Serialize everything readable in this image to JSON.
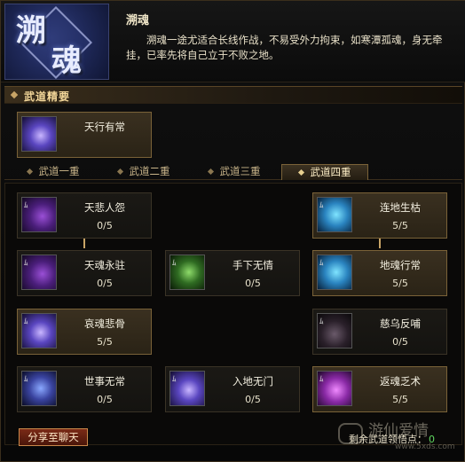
{
  "header": {
    "emblem_chars": [
      "溯",
      "魂"
    ],
    "title": "溯魂",
    "description": "溯魂一途尤适合长线作战，不易受外力拘束，如寒潭孤魂，身无牵挂，已率先将自己立于不败之地。"
  },
  "summary_section": {
    "title": "武道精要",
    "skill": {
      "name": "天行有常",
      "icon": "spirit-icon"
    }
  },
  "tabs": [
    {
      "label": "武道一重",
      "active": false
    },
    {
      "label": "武道二重",
      "active": false
    },
    {
      "label": "武道三重",
      "active": false
    },
    {
      "label": "武道四重",
      "active": true
    }
  ],
  "skill_level_symbol": "ﾑ",
  "skills": [
    {
      "name": "天悲人怨",
      "level": "0/5",
      "active": false,
      "icon": "purple-spirit-icon"
    },
    {
      "name": "连地生枯",
      "level": "5/5",
      "active": true,
      "icon": "blue-wave-icon"
    },
    {
      "name": "天魂永驻",
      "level": "0/5",
      "active": false,
      "icon": "purple-spirit-icon"
    },
    {
      "name": "手下无情",
      "level": "0/5",
      "active": false,
      "icon": "green-spirit-icon"
    },
    {
      "name": "地魂行常",
      "level": "5/5",
      "active": true,
      "icon": "blue-figure-icon"
    },
    {
      "name": "哀魂悲骨",
      "level": "5/5",
      "active": true,
      "icon": "violet-burst-icon"
    },
    {
      "name": "慈乌反哺",
      "level": "0/5",
      "active": false,
      "icon": "dark-crow-icon"
    },
    {
      "name": "世事无常",
      "level": "0/5",
      "active": false,
      "icon": "indigo-spirit-icon"
    },
    {
      "name": "入地无门",
      "level": "0/5",
      "active": false,
      "icon": "violet-burst-icon"
    },
    {
      "name": "返魂乏术",
      "level": "5/5",
      "active": true,
      "icon": "magenta-spirit-icon"
    }
  ],
  "footer": {
    "share_label": "分享至聊天",
    "remaining_label": "剩余武道领悟点：",
    "remaining_value": "0"
  },
  "watermark": {
    "title": "游仙爱情",
    "url": "www.5xds.com"
  }
}
